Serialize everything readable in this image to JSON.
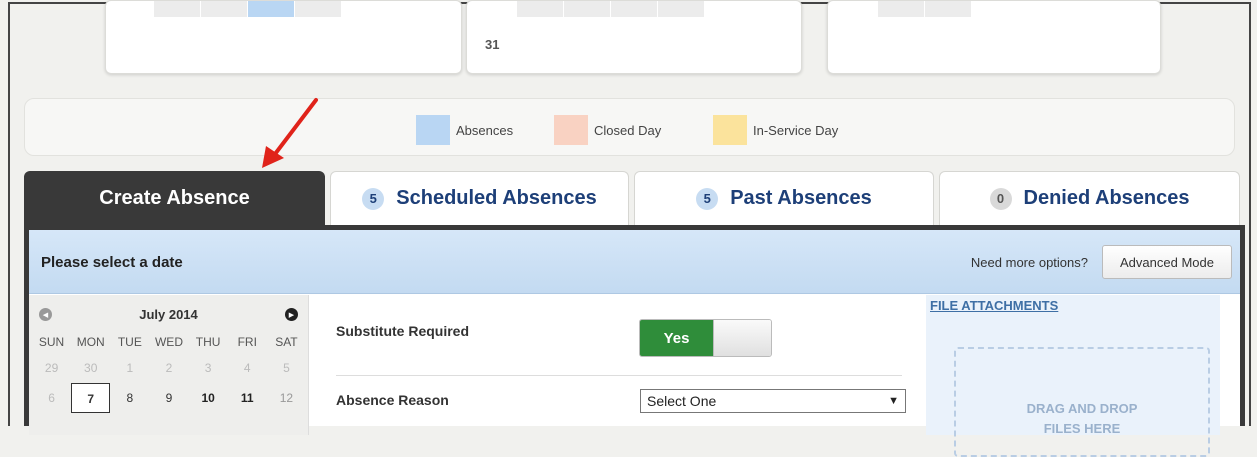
{
  "top_cards": [
    {
      "day_number": ""
    },
    {
      "day_number": "31"
    },
    {
      "day_number": ""
    }
  ],
  "legend": {
    "items": [
      {
        "label": "Absences",
        "color": "#b9d6f3"
      },
      {
        "label": "Closed Day",
        "color": "#f9d2c2"
      },
      {
        "label": "In-Service Day",
        "color": "#fbe39c"
      }
    ]
  },
  "annotation": {
    "arrow_color": "#e0231a"
  },
  "tabs": [
    {
      "label": "Create Absence",
      "badge": "",
      "active": true
    },
    {
      "label": "Scheduled Absences",
      "badge": "5",
      "active": false
    },
    {
      "label": "Past Absences",
      "badge": "5",
      "active": false
    },
    {
      "label": "Denied Absences",
      "badge": "0",
      "active": false
    }
  ],
  "panel": {
    "header_title": "Please select a date",
    "need_more_text": "Need more options?",
    "advanced_button": "Advanced Mode"
  },
  "calendar": {
    "month_label": "July 2014",
    "weekdays": [
      "SUN",
      "MON",
      "TUE",
      "WED",
      "THU",
      "FRI",
      "SAT"
    ],
    "rows": [
      [
        "29",
        "30",
        "1",
        "2",
        "3",
        "4",
        "5"
      ],
      [
        "6",
        "7",
        "8",
        "9",
        "10",
        "11",
        "12"
      ]
    ],
    "selected_day": "7"
  },
  "form": {
    "substitute_label": "Substitute Required",
    "substitute_value": "Yes",
    "reason_label": "Absence Reason",
    "reason_select": "Select One"
  },
  "attachments": {
    "title": "FILE ATTACHMENTS",
    "drop_line1": "DRAG AND DROP",
    "drop_line2": "FILES HERE"
  }
}
